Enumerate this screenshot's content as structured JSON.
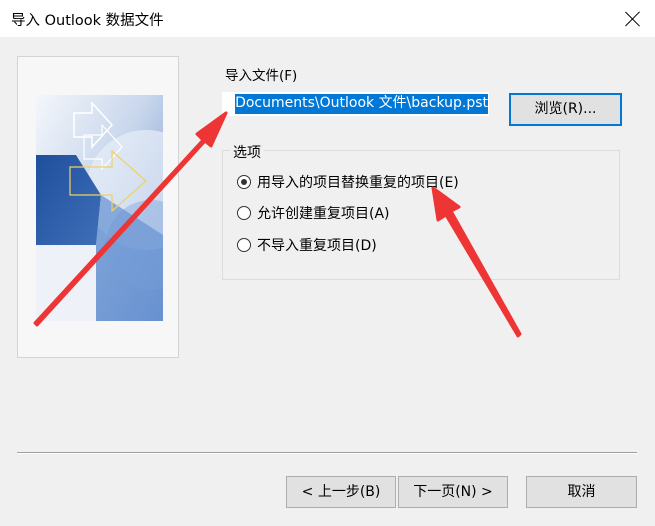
{
  "window": {
    "title": "导入 Outlook 数据文件"
  },
  "file": {
    "label": "导入文件(F)",
    "path_value": "Documents\\Outlook 文件\\backup.pst",
    "browse_label": "浏览(R)..."
  },
  "options": {
    "group_title": "选项",
    "items": [
      {
        "label": "用导入的项目替换重复的项目(E)",
        "selected": true
      },
      {
        "label": "允许创建重复项目(A)",
        "selected": false
      },
      {
        "label": "不导入重复项目(D)",
        "selected": false
      }
    ]
  },
  "buttons": {
    "back": "< 上一步(B)",
    "next": "下一页(N) >",
    "cancel": "取消"
  },
  "colors": {
    "selection": "#0078d7",
    "annotation": "#ee3535"
  },
  "icons": {
    "close": "close-icon"
  }
}
